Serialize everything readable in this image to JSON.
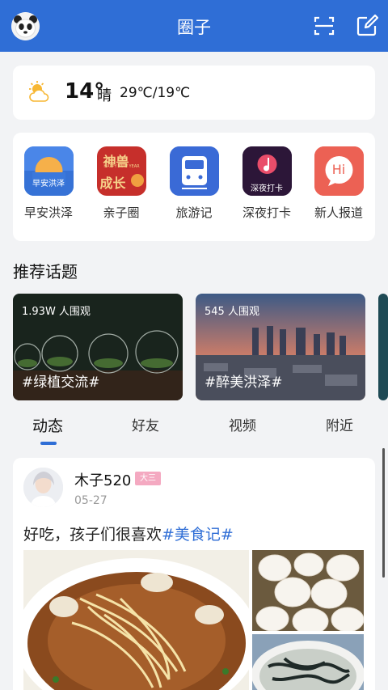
{
  "header": {
    "title": "圈子"
  },
  "weather": {
    "temp": "14°",
    "condition": "晴",
    "range": "29℃/19℃"
  },
  "apps": [
    {
      "label": "早安洪泽",
      "icon_text": "早安洪泽",
      "icon": "sunrise-icon"
    },
    {
      "label": "亲子圈",
      "icon_text_1": "神兽",
      "icon_text_2": "成长",
      "icon_text_3": "HAPPY NEW YEAR",
      "icon": "parent-child-icon"
    },
    {
      "label": "旅游记",
      "icon": "train-icon"
    },
    {
      "label": "深夜打卡",
      "icon_text": "深夜打卡",
      "icon": "music-icon"
    },
    {
      "label": "新人报道",
      "icon_text": "Hi",
      "icon": "hi-chat-icon"
    }
  ],
  "section": {
    "title": "推荐话题"
  },
  "topics": [
    {
      "views": "1.93W 人围观",
      "tag": "#绿植交流#"
    },
    {
      "views": "545 人围观",
      "tag": "#醉美洪泽#"
    }
  ],
  "tabs": [
    "动态",
    "好友",
    "视频",
    "附近"
  ],
  "post": {
    "user": "木子520",
    "badge": "大三",
    "date": "05-27",
    "text": "好吃，孩子们很喜欢",
    "hashtag": "#美食记#"
  },
  "colors": {
    "brand": "#2f6ed6",
    "badge": "#f4a9c1"
  }
}
